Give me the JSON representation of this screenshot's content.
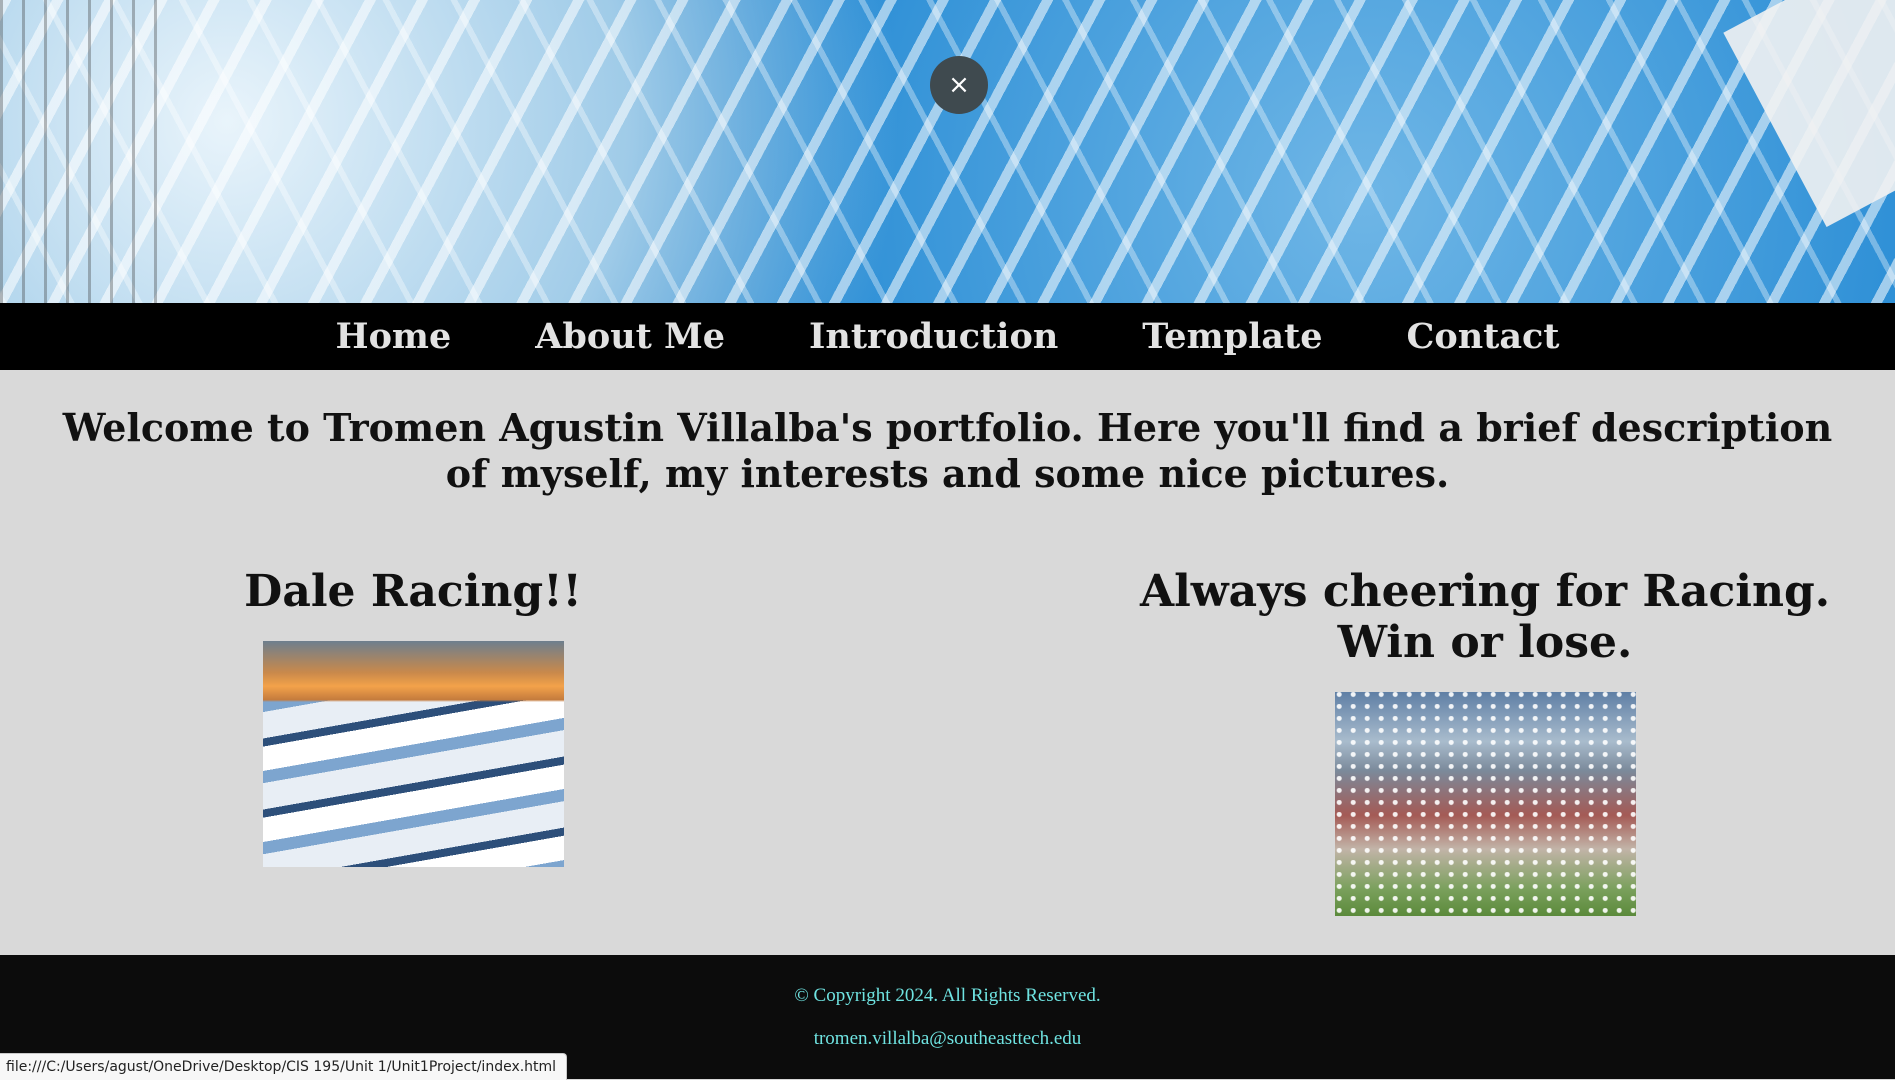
{
  "overlay": {
    "close_icon_glyph": "×"
  },
  "nav": {
    "items": [
      {
        "label": "Home"
      },
      {
        "label": "About Me"
      },
      {
        "label": "Introduction"
      },
      {
        "label": "Template"
      },
      {
        "label": "Contact"
      }
    ]
  },
  "main": {
    "welcome_text": "Welcome to Tromen Agustin Villalba's portfolio. Here you'll find a brief description of myself, my interests and some nice pictures.",
    "left": {
      "heading": "Dale Racing!!"
    },
    "right": {
      "heading": "Always cheering for Racing. Win or lose."
    }
  },
  "footer": {
    "copyright": "© Copyright 2024. All Rights Reserved.",
    "email": "tromen.villalba@southeasttech.edu"
  },
  "status_bar": {
    "url": "file:///C:/Users/agust/OneDrive/Desktop/CIS 195/Unit 1/Unit1Project/index.html"
  },
  "colors": {
    "nav_bg": "#000000",
    "page_bg": "#d9d9d9",
    "footer_bg": "#0c0c0c",
    "footer_text": "#6fe3e1"
  }
}
